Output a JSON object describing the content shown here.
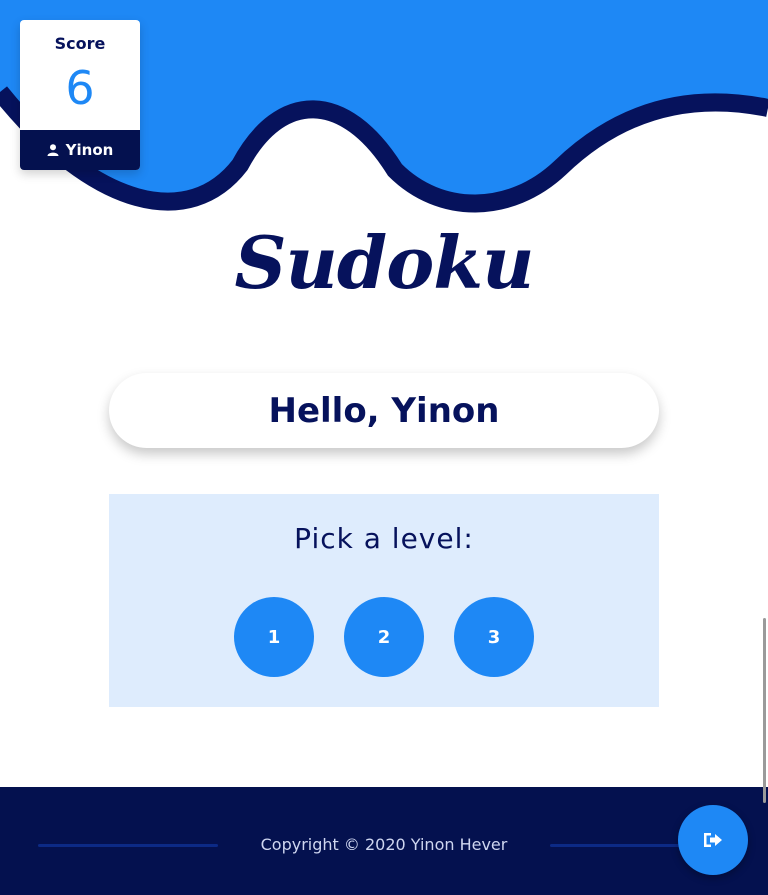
{
  "score_card": {
    "title": "Score",
    "value": "6",
    "username": "Yinon",
    "user_icon": "user-icon"
  },
  "app_title": "Sudoku",
  "greeting": "Hello, Yinon",
  "levels": {
    "prompt": "Pick a level:",
    "options": [
      "1",
      "2",
      "3"
    ]
  },
  "footer": {
    "copyright": "Copyright © 2020 Yinon Hever"
  },
  "logout": {
    "icon": "sign-out-icon"
  },
  "colors": {
    "accent": "#1e88f5",
    "navy": "#04114f",
    "panel": "#deecfd"
  }
}
